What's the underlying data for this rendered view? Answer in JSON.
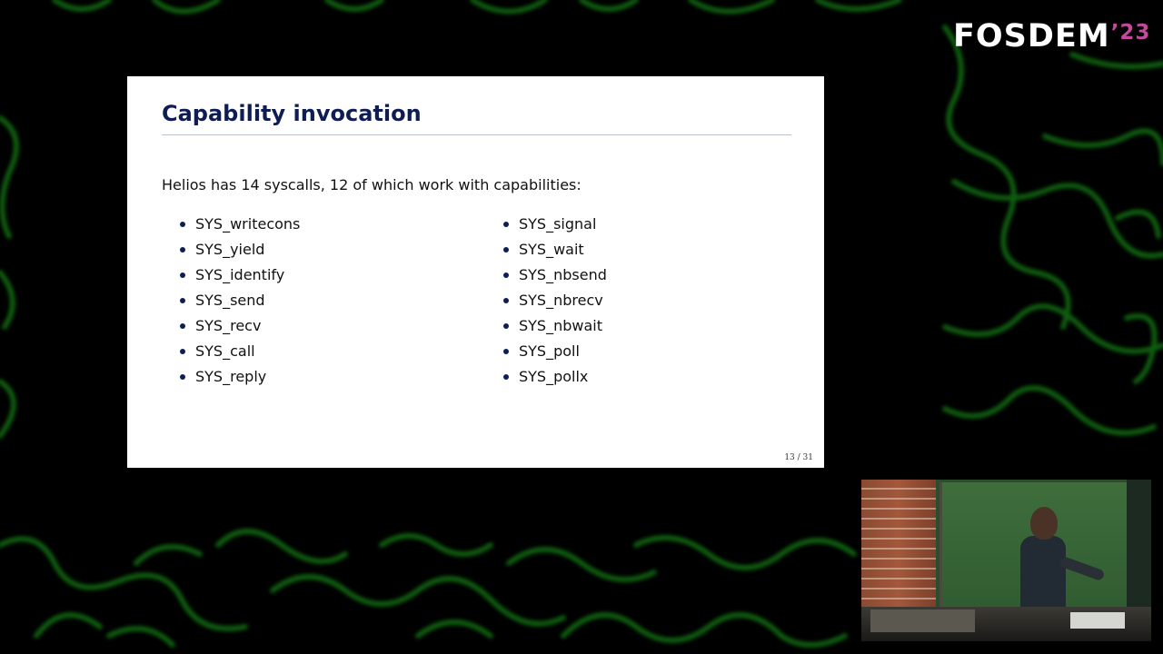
{
  "branding": {
    "logo_text": "FOSDEM",
    "year": "’23",
    "accent_color": "#c34a9c",
    "pattern_color": "#2fd12f"
  },
  "slide": {
    "title": "Capability invocation",
    "intro": "Helios has 14 syscalls, 12 of which work with capabilities:",
    "left_column": [
      "SYS_writecons",
      "SYS_yield",
      "SYS_identify",
      "SYS_send",
      "SYS_recv",
      "SYS_call",
      "SYS_reply"
    ],
    "right_column": [
      "SYS_signal",
      "SYS_wait",
      "SYS_nbsend",
      "SYS_nbrecv",
      "SYS_nbwait",
      "SYS_poll",
      "SYS_pollx"
    ],
    "page_number": "13 / 31",
    "title_color": "#0f1d55"
  },
  "camera": {
    "content": "speaker-video-feed"
  }
}
